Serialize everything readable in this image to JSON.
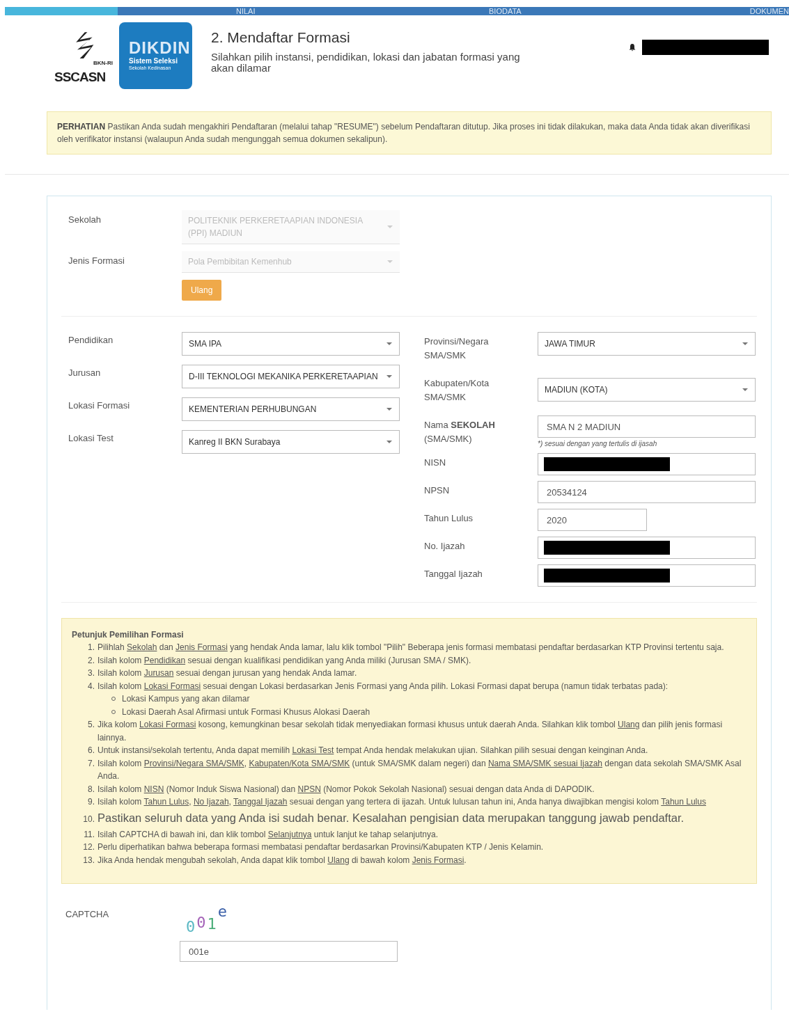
{
  "nav": {
    "steps": [
      {
        "label": "NILAI"
      },
      {
        "label": "BIODATA"
      },
      {
        "label": "DOKUMEN"
      }
    ]
  },
  "header": {
    "logo": {
      "brand": "SSCASN",
      "brand_tag": "BKN-RI",
      "card_title": "DIKDIN",
      "card_line1": "Sistem Seleksi",
      "card_line2": "Sekolah Kedinasan"
    },
    "title": "2. Mendaftar Formasi",
    "subtitle": "Silahkan pilih instansi, pendidikan, lokasi dan jabatan formasi yang akan dilamar"
  },
  "alert": {
    "lead": "PERHATIAN",
    "text": "Pastikan Anda sudah mengakhiri Pendaftaran (melalui tahap \"RESUME\") sebelum Pendaftaran ditutup. Jika proses ini tidak dilakukan, maka data Anda tidak akan diverifikasi oleh verifikator instansi (walaupun Anda sudah mengunggah semua dokumen sekalipun)."
  },
  "school_section": {
    "fields": [
      {
        "label": "Sekolah",
        "value": "POLITEKNIK PERKERETAAPIAN INDONESIA (PPI) MADIUN",
        "disabled": true
      },
      {
        "label": "Jenis Formasi",
        "value": "Pola Pembibitan Kemenhub",
        "disabled": true
      }
    ],
    "reset_button": "Ulang"
  },
  "left_fields": [
    {
      "label": "Pendidikan",
      "value": "SMA IPA"
    },
    {
      "label": "Jurusan",
      "value": "D-III TEKNOLOGI MEKANIKA PERKERETAAPIAN"
    },
    {
      "label": "Lokasi Formasi",
      "value": "KEMENTERIAN PERHUBUNGAN"
    },
    {
      "label": "Lokasi Test",
      "value": "Kanreg II BKN Surabaya"
    }
  ],
  "right_fields": [
    {
      "kind": "select",
      "label": "Provinsi/Negara SMA/SMK",
      "value": "JAWA TIMUR"
    },
    {
      "kind": "select",
      "label": "Kabupaten/Kota SMA/SMK",
      "value": "MADIUN (KOTA)"
    },
    {
      "kind": "input",
      "label": "Nama **SEKOLAH** (SMA/SMK)",
      "value": "SMA N 2 MADIUN",
      "note": "*) sesuai dengan yang tertulis di ijasah"
    },
    {
      "kind": "redacted",
      "label": "NISN"
    },
    {
      "kind": "input",
      "label": "NPSN",
      "value": "20534124"
    },
    {
      "kind": "short",
      "label": "Tahun Lulus",
      "value": "2020"
    },
    {
      "kind": "redacted",
      "label": "No. Ijazah"
    },
    {
      "kind": "redacted",
      "label": "Tanggal Ijazah"
    }
  ],
  "instructions": {
    "title": "Petunjuk Pemilihan Formasi",
    "items": [
      {
        "number": "1.",
        "parts": [
          {
            "kind": "text",
            "t": "Pilihlah "
          },
          {
            "kind": "link",
            "t": "Sekolah"
          },
          {
            "kind": "text",
            "t": " dan "
          },
          {
            "kind": "link",
            "t": "Jenis Formasi"
          },
          {
            "kind": "text",
            "t": " yang hendak Anda lamar, lalu klik tombol \"Pilih\" Beberapa jenis formasi membatasi pendaftar berdasarkan KTP Provinsi tertentu saja."
          }
        ]
      },
      {
        "number": "2.",
        "parts": [
          {
            "kind": "text",
            "t": "Isilah kolom "
          },
          {
            "kind": "link",
            "t": "Pendidikan"
          },
          {
            "kind": "text",
            "t": " sesuai dengan kualifikasi pendidikan yang Anda miliki (Jurusan SMA / SMK)."
          }
        ]
      },
      {
        "number": "3.",
        "parts": [
          {
            "kind": "text",
            "t": "Isilah kolom "
          },
          {
            "kind": "link",
            "t": "Jurusan"
          },
          {
            "kind": "text",
            "t": " sesuai dengan jurusan yang hendak Anda lamar."
          }
        ]
      },
      {
        "number": "4.",
        "parts": [
          {
            "kind": "text",
            "t": "Isilah kolom "
          },
          {
            "kind": "link",
            "t": "Lokasi Formasi"
          },
          {
            "kind": "text",
            "t": " sesuai dengan Lokasi berdasarkan Jenis Formasi yang Anda pilih. Lokasi Formasi dapat berupa (namun tidak terbatas pada):"
          }
        ],
        "children": [
          "Lokasi Kampus yang akan dilamar",
          "Lokasi Daerah Asal Afirmasi untuk Formasi Khusus Alokasi Daerah"
        ]
      },
      {
        "number": "5.",
        "parts": [
          {
            "kind": "text",
            "t": "Jika kolom "
          },
          {
            "kind": "link",
            "t": "Lokasi Formasi"
          },
          {
            "kind": "text",
            "t": " kosong, kemungkinan besar sekolah tidak menyediakan formasi khusus untuk daerah Anda. Silahkan klik tombol "
          },
          {
            "kind": "link",
            "t": "Ulang"
          },
          {
            "kind": "text",
            "t": " dan pilih jenis formasi lainnya."
          }
        ]
      },
      {
        "number": "6.",
        "parts": [
          {
            "kind": "text",
            "t": "Untuk instansi/sekolah tertentu, Anda dapat memilih "
          },
          {
            "kind": "link",
            "t": "Lokasi Test"
          },
          {
            "kind": "text",
            "t": " tempat Anda hendak melakukan ujian. Silahkan pilih sesuai dengan keinginan Anda."
          }
        ]
      },
      {
        "number": "7.",
        "parts": [
          {
            "kind": "text",
            "t": "Isilah kolom "
          },
          {
            "kind": "link",
            "t": "Provinsi/Negara SMA/SMK"
          },
          {
            "kind": "text",
            "t": ", "
          },
          {
            "kind": "link",
            "t": "Kabupaten/Kota SMA/SMK"
          },
          {
            "kind": "text",
            "t": " (untuk SMA/SMK dalam negeri) dan "
          },
          {
            "kind": "link",
            "t": "Nama SMA/SMK sesuai Ijazah"
          },
          {
            "kind": "text",
            "t": " dengan data sekolah SMA/SMK Asal Anda."
          }
        ]
      },
      {
        "number": "8.",
        "parts": [
          {
            "kind": "text",
            "t": "Isilah kolom "
          },
          {
            "kind": "link",
            "t": "NISN"
          },
          {
            "kind": "text",
            "t": " (Nomor Induk Siswa Nasional) dan "
          },
          {
            "kind": "link",
            "t": "NPSN"
          },
          {
            "kind": "text",
            "t": " (Nomor Pokok Sekolah Nasional) sesuai dengan data Anda di DAPODIK."
          }
        ]
      },
      {
        "number": "9.",
        "parts": [
          {
            "kind": "text",
            "t": "Isilah kolom "
          },
          {
            "kind": "link",
            "t": "Tahun Lulus"
          },
          {
            "kind": "text",
            "t": ", "
          },
          {
            "kind": "link",
            "t": "No Ijazah"
          },
          {
            "kind": "text",
            "t": ", "
          },
          {
            "kind": "link",
            "t": "Tanggal Ijazah"
          },
          {
            "kind": "text",
            "t": " sesuai dengan yang tertera di ijazah. Untuk lulusan tahun ini, Anda hanya diwajibkan mengisi kolom "
          },
          {
            "kind": "link",
            "t": "Tahun Lulus"
          }
        ]
      },
      {
        "number": "10.",
        "large": true,
        "parts": [
          {
            "kind": "text",
            "t": "Pastikan seluruh data yang Anda isi sudah benar. Kesalahan pengisian data merupakan tanggung jawab pendaftar."
          }
        ]
      },
      {
        "number": "11.",
        "parts": [
          {
            "kind": "text",
            "t": "Isilah CAPTCHA di bawah ini, dan klik tombol "
          },
          {
            "kind": "link",
            "t": "Selanjutnya"
          },
          {
            "kind": "text",
            "t": " untuk lanjut ke tahap selanjutnya."
          }
        ]
      },
      {
        "number": "12.",
        "parts": [
          {
            "kind": "text",
            "t": "Perlu diperhatikan bahwa beberapa formasi membatasi pendaftar berdasarkan Provinsi/Kabupaten KTP / Jenis Kelamin."
          }
        ]
      },
      {
        "number": "13.",
        "parts": [
          {
            "kind": "text",
            "t": "Jika Anda hendak mengubah sekolah, Anda dapat klik tombol "
          },
          {
            "kind": "link",
            "t": "Ulang"
          },
          {
            "kind": "text",
            "t": " di bawah kolom "
          },
          {
            "kind": "link",
            "t": "Jenis Formasi"
          },
          {
            "kind": "text",
            "t": "."
          }
        ]
      }
    ]
  },
  "captcha": {
    "label": "CAPTCHA",
    "chars": [
      {
        "c": "0",
        "color": "#5bb8c4"
      },
      {
        "c": "0",
        "color": "#a463b8"
      },
      {
        "c": "1",
        "color": "#4cad7a"
      },
      {
        "c": "e",
        "color": "#3a5fa8"
      }
    ],
    "value": "001e"
  }
}
